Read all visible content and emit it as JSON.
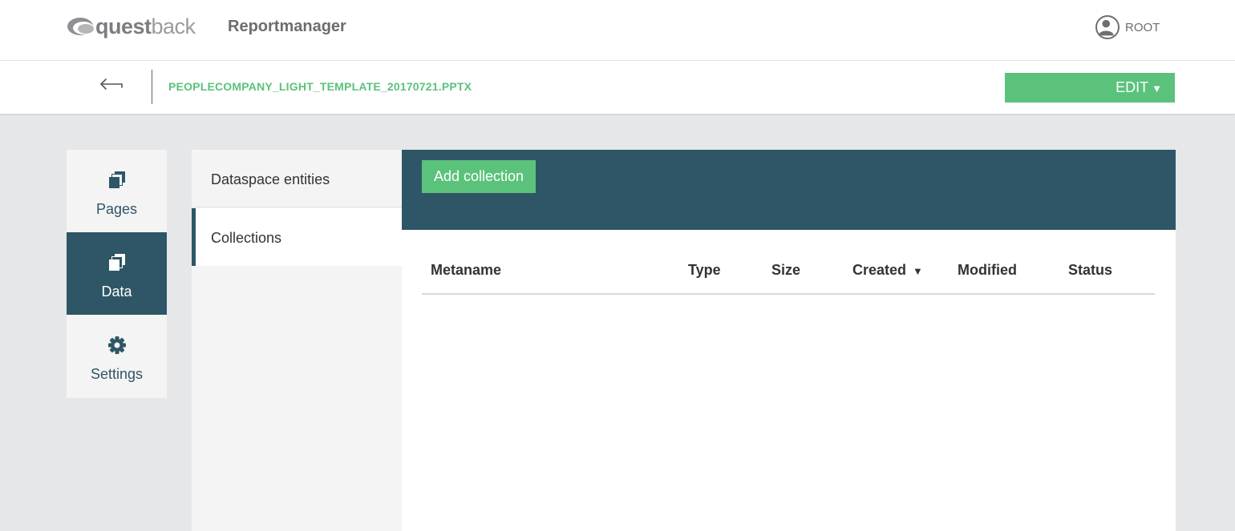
{
  "header": {
    "logo_bold": "quest",
    "logo_light": "back",
    "app_name": "Reportmanager",
    "user_label": "ROOT"
  },
  "subheader": {
    "file_name": "PEOPLECOMPANY_LIGHT_TEMPLATE_20170721.PPTX",
    "edit_label": "EDIT",
    "edit_caret": "▼"
  },
  "leftnav": {
    "items": [
      {
        "label": "Pages",
        "icon": "pages-icon"
      },
      {
        "label": "Data",
        "icon": "data-icon",
        "active": true
      },
      {
        "label": "Settings",
        "icon": "gear-icon"
      }
    ]
  },
  "subnav": {
    "items": [
      {
        "label": "Dataspace entities"
      },
      {
        "label": "Collections",
        "active": true
      }
    ]
  },
  "main": {
    "add_button": "Add collection",
    "columns": [
      "Metaname",
      "Type",
      "Size",
      "Created",
      "Modified",
      "Status"
    ],
    "sort_indicator": "▼",
    "rows": []
  },
  "colors": {
    "accent_green": "#5bc27b",
    "dark_teal": "#2f5666",
    "background": "#e6e7e9"
  }
}
